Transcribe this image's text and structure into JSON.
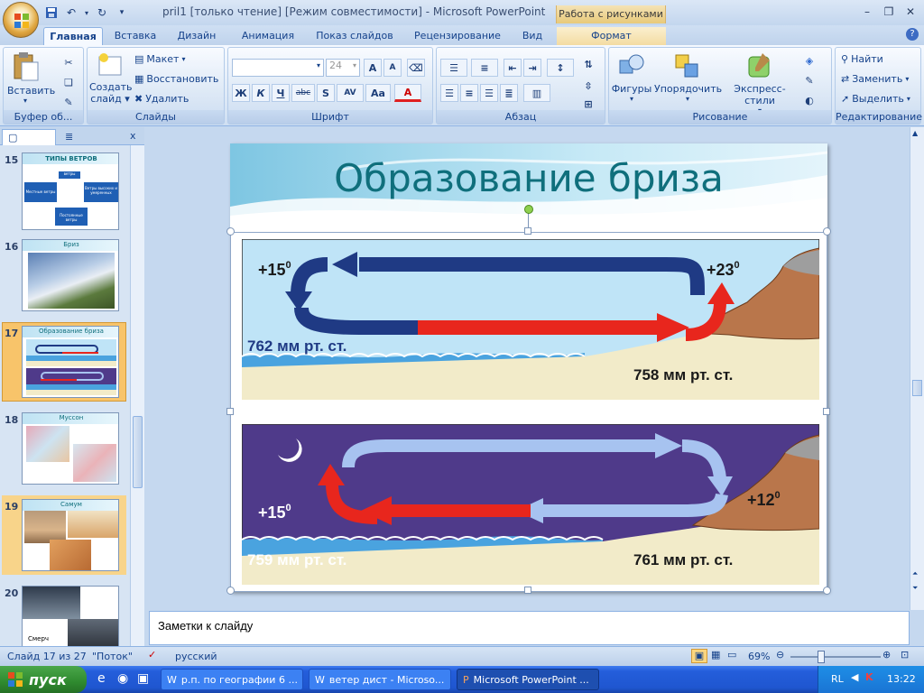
{
  "titlebar": {
    "title": "pril1 [только чтение] [Режим совместимости] - Microsoft PowerPoint",
    "context_group": "Работа с рисунками"
  },
  "tabs": [
    "Главная",
    "Вставка",
    "Дизайн",
    "Анимация",
    "Показ слайдов",
    "Рецензирование",
    "Вид",
    "Формат"
  ],
  "ribbon": {
    "clipboard": {
      "paste": "Вставить",
      "title": "Буфер об..."
    },
    "slides": {
      "new_slide_l1": "Создать",
      "new_slide_l2": "слайд",
      "layout": "Макет",
      "reset": "Восстановить",
      "delete": "Удалить",
      "title": "Слайды"
    },
    "font": {
      "font_name": "",
      "font_size": "24",
      "title": "Шрифт",
      "bold": "Ж",
      "italic": "К",
      "underline": "Ч",
      "strike": "abc",
      "shadow": "S",
      "spacing": "AV",
      "case": "Aa",
      "color": "A",
      "grow": "A",
      "shrink": "A"
    },
    "paragraph": {
      "title": "Абзац"
    },
    "drawing": {
      "shapes": "Фигуры",
      "arrange": "Упорядочить",
      "quick_styles": "Экспресс-стили",
      "title": "Рисование"
    },
    "editing": {
      "find": "Найти",
      "replace": "Заменить",
      "select": "Выделить",
      "title": "Редактирование"
    }
  },
  "thumbnails": [
    {
      "num": "15",
      "title": "ТИПЫ ВЕТРОВ",
      "boxes": [
        "ветры",
        "Местные ветры",
        "Ветры высоких и умеренных",
        "Постоянные ветры"
      ]
    },
    {
      "num": "16",
      "title": "Бриз"
    },
    {
      "num": "17",
      "title": "Образование бриза"
    },
    {
      "num": "18",
      "title": "Муссон"
    },
    {
      "num": "19",
      "title": "Самум"
    },
    {
      "num": "20",
      "title": "Смерч"
    }
  ],
  "slide": {
    "title": "Образование бриза",
    "day": {
      "temp_sea": "+15",
      "temp_land": "+23",
      "pressure_sea": "762 мм рт. ст.",
      "pressure_land": "758 мм рт. ст.",
      "sup": "0"
    },
    "night": {
      "temp_sea": "+15",
      "temp_land": "+12",
      "pressure_sea": "759 мм рт. ст.",
      "pressure_land": "761 мм рт. ст.",
      "sup": "0"
    }
  },
  "notes": {
    "placeholder": "Заметки к слайду"
  },
  "status": {
    "slide": "Слайд 17 из 27",
    "theme": "\"Поток\"",
    "lang": "русский",
    "zoom": "69%"
  },
  "taskbar": {
    "start": "пуск",
    "tasks": [
      "р.п. по географии 6 ...",
      "ветер дист - Microso...",
      "Microsoft PowerPoint ..."
    ],
    "lang": "RL",
    "time": "13:22"
  },
  "colors": {
    "day_sky": "#bfe4f7",
    "night_sky": "#4f3a8a",
    "sea": "#4aa3df",
    "land": "#f2ebc9",
    "mountain": "#b9764b",
    "warm_arrow": "#e8261d",
    "cool_arrow": "#1f3a84",
    "title": "#0f6f7c"
  }
}
